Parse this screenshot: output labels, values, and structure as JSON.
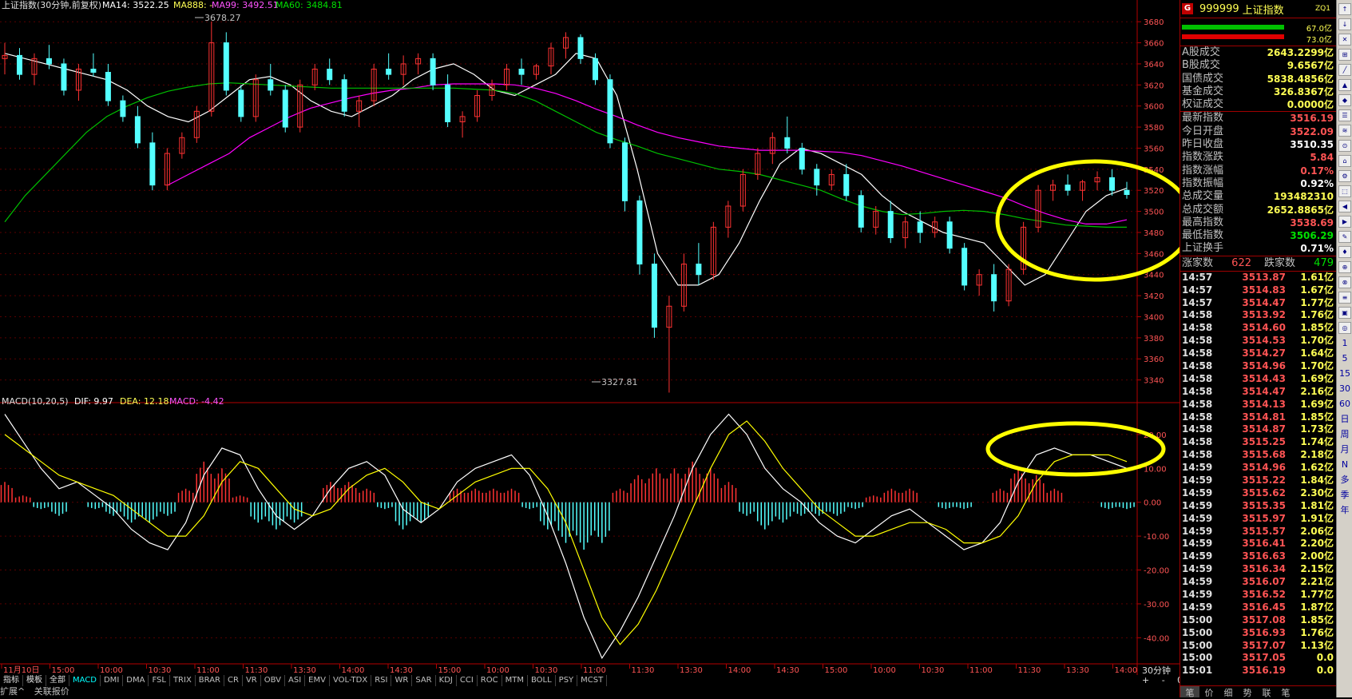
{
  "chart_title": "上证指数(30分钟,前复权)",
  "ma_legend": {
    "ma14": "MA14: 3522.25",
    "ma888": "MA888: -",
    "ma99": "MA99: 3492.51",
    "ma60": "MA60: 3484.81"
  },
  "macd_legend": {
    "title": "MACD(10,20,5)",
    "dif": "DIF: 9.97",
    "dea": "DEA: 12.18",
    "macd": "MACD: -4.42"
  },
  "price_ticks": [
    "3680",
    "3660",
    "3640",
    "3620",
    "3600",
    "3580",
    "3560",
    "3540",
    "3520",
    "3500",
    "3480",
    "3460",
    "3440",
    "3420",
    "3400",
    "3380",
    "3360",
    "3340"
  ],
  "macd_ticks": [
    "20.00",
    "10.00",
    "0.00",
    "-10.00",
    "-20.00",
    "-30.00",
    "-40.00"
  ],
  "time_labels": [
    "11月10日",
    "15:00",
    "10:00",
    "10:30",
    "11:00",
    "11:30",
    "13:30",
    "14:00",
    "14:30",
    "15:00",
    "10:00",
    "10:30",
    "11:00",
    "11:30",
    "13:30",
    "14:00",
    "14:30",
    "15:00",
    "10:00",
    "10:30",
    "11:00",
    "11:30",
    "13:30",
    "14:00"
  ],
  "high_label": "3678.27",
  "low_label": "3327.81",
  "timeframe": "30分钟",
  "pm_label": "+ - 0",
  "indicator_tabs": [
    "指标",
    "模板",
    "全部",
    "MACD",
    "DMI",
    "DMA",
    "FSL",
    "TRIX",
    "BRAR",
    "CR",
    "VR",
    "OBV",
    "ASI",
    "EMV",
    "VOL-TDX",
    "RSI",
    "WR",
    "SAR",
    "KDJ",
    "CCI",
    "ROC",
    "MTM",
    "BOLL",
    "PSY",
    "MCST"
  ],
  "bottom_items": [
    "扩展^",
    "关联报价"
  ],
  "colors": {
    "up": "#ff3232",
    "down": "#54ffff",
    "ma14": "#ffffff",
    "ma99": "#ff00ff",
    "ma60": "#00c000",
    "dea": "#ffff00",
    "axis": "#b40000",
    "highlight": "#ffff00"
  },
  "panel": {
    "badge": "G",
    "code": "999999",
    "name": "上证指数",
    "zq": "ZQ1",
    "bar_top": "67.0亿",
    "bar_bottom": "73.0亿",
    "turnover": [
      {
        "k": "A股成交",
        "v": "2643.2299亿"
      },
      {
        "k": "B股成交",
        "v": "9.6567亿"
      },
      {
        "k": "国债成交",
        "v": "5838.4856亿"
      },
      {
        "k": "基金成交",
        "v": "326.8367亿"
      },
      {
        "k": "权证成交",
        "v": "0.0000亿"
      }
    ],
    "stats": [
      {
        "k": "最新指数",
        "v": "3516.19",
        "c": "#ff5454"
      },
      {
        "k": "今日开盘",
        "v": "3522.09",
        "c": "#ff5454"
      },
      {
        "k": "昨日收盘",
        "v": "3510.35",
        "c": "#ffffff"
      },
      {
        "k": "指数涨跌",
        "v": "5.84",
        "c": "#ff5454"
      },
      {
        "k": "指数涨幅",
        "v": "0.17%",
        "c": "#ff5454"
      },
      {
        "k": "指数振幅",
        "v": "0.92%",
        "c": "#ffffff"
      },
      {
        "k": "总成交量",
        "v": "193482310",
        "c": "#ffff54"
      },
      {
        "k": "总成交额",
        "v": "2652.8865亿",
        "c": "#ffff54"
      },
      {
        "k": "最高指数",
        "v": "3538.69",
        "c": "#ff5454"
      },
      {
        "k": "最低指数",
        "v": "3506.29",
        "c": "#00e000"
      },
      {
        "k": "上证换手",
        "v": "0.71%",
        "c": "#ffffff"
      }
    ],
    "up_label": "涨家数",
    "up_count": "622",
    "down_label": "跌家数",
    "down_count": "479",
    "ticks": [
      [
        "14:57",
        "3513.87",
        "1.61亿"
      ],
      [
        "14:57",
        "3514.83",
        "1.67亿"
      ],
      [
        "14:57",
        "3514.47",
        "1.77亿"
      ],
      [
        "14:58",
        "3513.92",
        "1.76亿"
      ],
      [
        "14:58",
        "3514.60",
        "1.85亿"
      ],
      [
        "14:58",
        "3514.53",
        "1.70亿"
      ],
      [
        "14:58",
        "3514.27",
        "1.64亿"
      ],
      [
        "14:58",
        "3514.96",
        "1.70亿"
      ],
      [
        "14:58",
        "3514.43",
        "1.69亿"
      ],
      [
        "14:58",
        "3514.47",
        "2.16亿"
      ],
      [
        "14:58",
        "3514.13",
        "1.69亿"
      ],
      [
        "14:58",
        "3514.81",
        "1.85亿"
      ],
      [
        "14:58",
        "3514.87",
        "1.73亿"
      ],
      [
        "14:58",
        "3515.25",
        "1.74亿"
      ],
      [
        "14:58",
        "3515.68",
        "2.18亿"
      ],
      [
        "14:59",
        "3514.96",
        "1.62亿"
      ],
      [
        "14:59",
        "3515.22",
        "1.84亿"
      ],
      [
        "14:59",
        "3515.62",
        "2.30亿"
      ],
      [
        "14:59",
        "3515.35",
        "1.81亿"
      ],
      [
        "14:59",
        "3515.97",
        "1.91亿"
      ],
      [
        "14:59",
        "3515.57",
        "2.06亿"
      ],
      [
        "14:59",
        "3516.41",
        "2.20亿"
      ],
      [
        "14:59",
        "3516.63",
        "2.00亿"
      ],
      [
        "14:59",
        "3516.34",
        "2.15亿"
      ],
      [
        "14:59",
        "3516.07",
        "2.21亿"
      ],
      [
        "14:59",
        "3516.52",
        "1.77亿"
      ],
      [
        "14:59",
        "3516.45",
        "1.87亿"
      ],
      [
        "15:00",
        "3517.08",
        "1.85亿"
      ],
      [
        "15:00",
        "3516.93",
        "1.76亿"
      ],
      [
        "15:00",
        "3517.07",
        "1.13亿"
      ],
      [
        "15:00",
        "3517.05",
        "0.0"
      ],
      [
        "15:01",
        "3516.19",
        "0.0"
      ]
    ],
    "bottom_tabs": [
      "笔",
      "价",
      "细",
      "势",
      "联",
      "笔"
    ]
  },
  "sidebar_labels": [
    "1",
    "5",
    "15",
    "30",
    "60",
    "日",
    "周",
    "月",
    "N",
    "多",
    "季",
    "年"
  ],
  "chart_data": [
    {
      "type": "candlestick",
      "title": "上证指数(30分钟,前复权)",
      "ylim": [
        3320,
        3690
      ],
      "ma_lines": [
        {
          "name": "MA14",
          "color": "#ffffff",
          "values": [
            3650,
            3645,
            3640,
            3635,
            3630,
            3625,
            3615,
            3600,
            3590,
            3585,
            3595,
            3610,
            3625,
            3628,
            3620,
            3605,
            3595,
            3590,
            3600,
            3610,
            3625,
            3635,
            3640,
            3630,
            3615,
            3610,
            3620,
            3630,
            3650,
            3645,
            3610,
            3540,
            3460,
            3430,
            3430,
            3440,
            3470,
            3510,
            3545,
            3560,
            3555,
            3545,
            3535,
            3515,
            3500,
            3490,
            3480,
            3475,
            3470,
            3450,
            3430,
            3440,
            3470,
            3500,
            3515,
            3522
          ]
        },
        {
          "name": "MA99",
          "color": "#ff00ff",
          "values": [
            null,
            null,
            null,
            null,
            null,
            null,
            null,
            null,
            3525,
            3535,
            3545,
            3555,
            3570,
            3580,
            3590,
            3598,
            3603,
            3608,
            3612,
            3615,
            3617,
            3620,
            3621,
            3621,
            3621,
            3620,
            3617,
            3612,
            3605,
            3597,
            3590,
            3582,
            3575,
            3570,
            3566,
            3562,
            3560,
            3558,
            3558,
            3558,
            3557,
            3556,
            3553,
            3548,
            3543,
            3537,
            3531,
            3525,
            3519,
            3513,
            3505,
            3498,
            3492,
            3488,
            3488,
            3492
          ]
        },
        {
          "name": "MA60",
          "color": "#00c000",
          "values": [
            3490,
            3515,
            3535,
            3555,
            3575,
            3590,
            3600,
            3608,
            3614,
            3618,
            3621,
            3622,
            3621,
            3620,
            3619,
            3618,
            3617,
            3617,
            3617,
            3617,
            3617,
            3617,
            3617,
            3616,
            3615,
            3612,
            3605,
            3595,
            3585,
            3575,
            3568,
            3562,
            3555,
            3550,
            3545,
            3540,
            3538,
            3535,
            3530,
            3525,
            3520,
            3512,
            3505,
            3500,
            3497,
            3498,
            3500,
            3501,
            3500,
            3497,
            3493,
            3490,
            3487,
            3486,
            3485,
            3485
          ]
        }
      ],
      "candles_ohlc": [
        [
          3645,
          3660,
          3630,
          3648
        ],
        [
          3648,
          3655,
          3625,
          3630
        ],
        [
          3630,
          3650,
          3620,
          3645
        ],
        [
          3645,
          3658,
          3635,
          3640
        ],
        [
          3640,
          3645,
          3610,
          3615
        ],
        [
          3615,
          3640,
          3605,
          3635
        ],
        [
          3635,
          3650,
          3628,
          3632
        ],
        [
          3632,
          3640,
          3600,
          3605
        ],
        [
          3605,
          3610,
          3585,
          3590
        ],
        [
          3590,
          3600,
          3560,
          3565
        ],
        [
          3565,
          3575,
          3520,
          3525
        ],
        [
          3525,
          3560,
          3520,
          3555
        ],
        [
          3555,
          3575,
          3550,
          3570
        ],
        [
          3570,
          3600,
          3565,
          3595
        ],
        [
          3595,
          3680,
          3590,
          3660
        ],
        [
          3660,
          3670,
          3610,
          3615
        ],
        [
          3615,
          3620,
          3585,
          3590
        ],
        [
          3590,
          3630,
          3585,
          3625
        ],
        [
          3625,
          3640,
          3610,
          3615
        ],
        [
          3615,
          3620,
          3575,
          3580
        ],
        [
          3580,
          3625,
          3575,
          3620
        ],
        [
          3620,
          3640,
          3615,
          3635
        ],
        [
          3635,
          3645,
          3620,
          3625
        ],
        [
          3625,
          3630,
          3590,
          3595
        ],
        [
          3595,
          3610,
          3580,
          3605
        ],
        [
          3605,
          3640,
          3600,
          3635
        ],
        [
          3635,
          3650,
          3625,
          3630
        ],
        [
          3630,
          3648,
          3620,
          3640
        ],
        [
          3640,
          3650,
          3630,
          3645
        ],
        [
          3645,
          3650,
          3615,
          3620
        ],
        [
          3620,
          3630,
          3580,
          3585
        ],
        [
          3585,
          3595,
          3570,
          3590
        ],
        [
          3590,
          3615,
          3585,
          3610
        ],
        [
          3610,
          3625,
          3605,
          3620
        ],
        [
          3620,
          3640,
          3615,
          3635
        ],
        [
          3635,
          3645,
          3620,
          3630
        ],
        [
          3630,
          3640,
          3625,
          3638
        ],
        [
          3638,
          3660,
          3630,
          3655
        ],
        [
          3655,
          3670,
          3645,
          3665
        ],
        [
          3665,
          3668,
          3640,
          3645
        ],
        [
          3645,
          3650,
          3620,
          3625
        ],
        [
          3625,
          3630,
          3560,
          3565
        ],
        [
          3565,
          3570,
          3500,
          3510
        ],
        [
          3510,
          3515,
          3440,
          3450
        ],
        [
          3450,
          3460,
          3380,
          3390
        ],
        [
          3390,
          3420,
          3328,
          3410
        ],
        [
          3410,
          3460,
          3405,
          3450
        ],
        [
          3450,
          3470,
          3430,
          3440
        ],
        [
          3440,
          3490,
          3435,
          3485
        ],
        [
          3485,
          3510,
          3475,
          3505
        ],
        [
          3505,
          3540,
          3500,
          3535
        ],
        [
          3535,
          3560,
          3530,
          3555
        ],
        [
          3555,
          3575,
          3545,
          3570
        ],
        [
          3570,
          3590,
          3555,
          3560
        ],
        [
          3560,
          3565,
          3535,
          3540
        ],
        [
          3540,
          3545,
          3515,
          3525
        ],
        [
          3525,
          3540,
          3520,
          3535
        ],
        [
          3535,
          3545,
          3510,
          3515
        ],
        [
          3515,
          3520,
          3480,
          3485
        ],
        [
          3485,
          3505,
          3478,
          3500
        ],
        [
          3500,
          3510,
          3470,
          3475
        ],
        [
          3475,
          3495,
          3465,
          3490
        ],
        [
          3490,
          3500,
          3470,
          3480
        ],
        [
          3480,
          3495,
          3475,
          3490
        ],
        [
          3490,
          3495,
          3460,
          3465
        ],
        [
          3465,
          3470,
          3425,
          3430
        ],
        [
          3430,
          3445,
          3420,
          3440
        ],
        [
          3440,
          3450,
          3405,
          3415
        ],
        [
          3415,
          3450,
          3410,
          3445
        ],
        [
          3445,
          3490,
          3440,
          3485
        ],
        [
          3485,
          3525,
          3480,
          3520
        ],
        [
          3520,
          3530,
          3510,
          3525
        ],
        [
          3525,
          3535,
          3515,
          3520
        ],
        [
          3520,
          3530,
          3510,
          3528
        ],
        [
          3528,
          3538,
          3520,
          3532
        ],
        [
          3532,
          3540,
          3515,
          3520
        ],
        [
          3520,
          3528,
          3512,
          3516
        ]
      ]
    },
    {
      "type": "macd",
      "title": "MACD(10,20,5)",
      "ylim": [
        -47,
        28
      ],
      "series": [
        {
          "name": "DIF",
          "color": "#ffffff",
          "values": [
            26,
            18,
            10,
            4,
            6,
            2,
            -2,
            -8,
            -12,
            -14,
            -6,
            8,
            16,
            14,
            4,
            -4,
            -8,
            -4,
            4,
            10,
            12,
            8,
            -2,
            -6,
            -2,
            6,
            10,
            12,
            14,
            8,
            -4,
            -18,
            -34,
            -46,
            -38,
            -28,
            -16,
            -4,
            10,
            20,
            26,
            20,
            10,
            4,
            0,
            -6,
            -10,
            -12,
            -8,
            -4,
            -2,
            -6,
            -10,
            -14,
            -12,
            -6,
            6,
            14,
            16,
            14,
            14,
            12,
            10
          ]
        },
        {
          "name": "DEA",
          "color": "#ffff00",
          "values": [
            20,
            16,
            12,
            8,
            6,
            4,
            2,
            -2,
            -6,
            -10,
            -10,
            -4,
            6,
            12,
            10,
            4,
            -2,
            -4,
            -2,
            4,
            8,
            10,
            6,
            0,
            -2,
            2,
            6,
            8,
            10,
            10,
            4,
            -6,
            -20,
            -34,
            -42,
            -36,
            -26,
            -14,
            -2,
            10,
            20,
            24,
            18,
            10,
            4,
            -2,
            -6,
            -10,
            -10,
            -8,
            -6,
            -6,
            -8,
            -12,
            -12,
            -10,
            -4,
            6,
            12,
            14,
            14,
            14,
            12
          ]
        }
      ],
      "bars": [
        6,
        2,
        -2,
        -4,
        0,
        -2,
        -4,
        -6,
        -6,
        -4,
        4,
        12,
        10,
        2,
        -6,
        -8,
        -6,
        0,
        6,
        6,
        4,
        -2,
        -8,
        -6,
        0,
        4,
        4,
        4,
        4,
        -2,
        -8,
        -12,
        -14,
        -12,
        4,
        8,
        10,
        10,
        12,
        10,
        6,
        -4,
        -8,
        -6,
        -4,
        -4,
        -4,
        -2,
        2,
        4,
        4,
        0,
        -2,
        -2,
        0,
        4,
        10,
        8,
        4,
        0,
        0,
        -2,
        -2
      ]
    }
  ]
}
